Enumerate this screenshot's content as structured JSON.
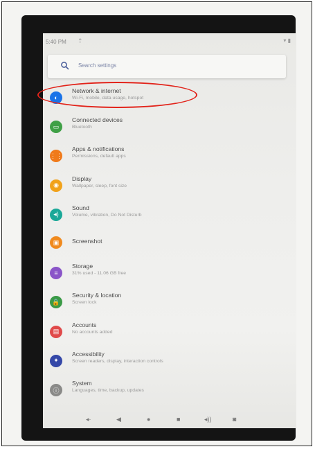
{
  "status_bar": {
    "time": "5:40 PM",
    "notification_icon": "upload-icon",
    "icons": "▾ ▮"
  },
  "search": {
    "placeholder": "Search settings"
  },
  "items": [
    {
      "title": "Network & internet",
      "subtitle": "Wi-Fi, mobile, data usage, hotspot",
      "icon": "wifi-icon",
      "color": "#1a73e8",
      "glyph": "◐"
    },
    {
      "title": "Connected devices",
      "subtitle": "Bluetooth",
      "icon": "devices-icon",
      "color": "#3fa046",
      "glyph": "▭"
    },
    {
      "title": "Apps & notifications",
      "subtitle": "Permissions, default apps",
      "icon": "apps-icon",
      "color": "#f07a1a",
      "glyph": "⋮⋮"
    },
    {
      "title": "Display",
      "subtitle": "Wallpaper, sleep, font size",
      "icon": "brightness-icon",
      "color": "#f1a21a",
      "glyph": "◉"
    },
    {
      "title": "Sound",
      "subtitle": "Volume, vibration, Do Not Disturb",
      "icon": "volume-icon",
      "color": "#1aa898",
      "glyph": "◂)"
    },
    {
      "title": "Screenshot",
      "subtitle": "",
      "icon": "camera-icon",
      "color": "#f08a1e",
      "glyph": "▣"
    },
    {
      "title": "Storage",
      "subtitle": "31% used - 11.06 GB free",
      "icon": "storage-icon",
      "color": "#8a55c8",
      "glyph": "≡"
    },
    {
      "title": "Security & location",
      "subtitle": "Screen lock",
      "icon": "lock-icon",
      "color": "#3a9a46",
      "glyph": "🔒"
    },
    {
      "title": "Accounts",
      "subtitle": "No accounts added",
      "icon": "accounts-icon",
      "color": "#e04a4a",
      "glyph": "▤"
    },
    {
      "title": "Accessibility",
      "subtitle": "Screen readers, display, interaction controls",
      "icon": "accessibility-icon",
      "color": "#3548a8",
      "glyph": "✦"
    },
    {
      "title": "System",
      "subtitle": "Languages, time, backup, updates",
      "icon": "info-icon",
      "color": "#8a8a88",
      "glyph": "ⓘ"
    }
  ],
  "navbar": {
    "buttons": [
      {
        "name": "volume-down-icon",
        "glyph": "◂·"
      },
      {
        "name": "back-icon",
        "glyph": "◀"
      },
      {
        "name": "home-icon",
        "glyph": "●"
      },
      {
        "name": "recents-icon",
        "glyph": "■"
      },
      {
        "name": "volume-up-icon",
        "glyph": "◂))"
      },
      {
        "name": "screenshot-icon",
        "glyph": "◙"
      }
    ]
  },
  "annotation": {
    "color": "#e2231a"
  }
}
